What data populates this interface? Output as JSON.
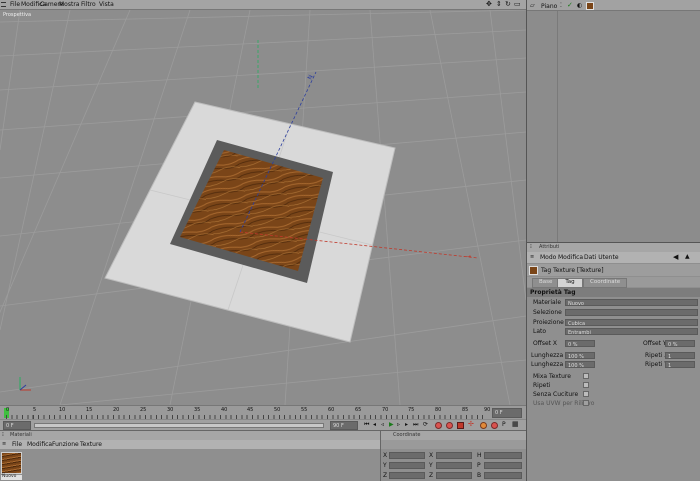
{
  "menu": {
    "items": [
      "File",
      "Modifica",
      "Camere",
      "Mostra",
      "Filtro",
      "Vista"
    ]
  },
  "viewport": {
    "label": "Prospettiva"
  },
  "object_manager": {
    "object_name": "Piano"
  },
  "timeline": {
    "ticks": [
      "0",
      "5",
      "10",
      "15",
      "20",
      "25",
      "30",
      "35",
      "40",
      "45",
      "50",
      "55",
      "60",
      "65",
      "70",
      "75",
      "80",
      "85",
      "90"
    ],
    "frame_right": "0 F",
    "start_frame": "0 F",
    "end_frame": "90 F"
  },
  "material_manager": {
    "title": "Materiali",
    "menu": [
      "File",
      "Modifica",
      "Funzione",
      "Texture"
    ],
    "material_name": "Nuovo"
  },
  "coordinates": {
    "title": "Coordinate",
    "rows": [
      {
        "a": "X",
        "b": "X",
        "c": "H"
      },
      {
        "a": "Y",
        "b": "Y",
        "c": "P"
      },
      {
        "a": "Z",
        "b": "Z",
        "c": "B"
      }
    ]
  },
  "attributes": {
    "title": "Attributi",
    "menu": [
      "Modo",
      "Modifica",
      "Dati Utente"
    ],
    "tag_title": "Tag Texture [Texture]",
    "tabs": [
      "Base",
      "Tag",
      "Coordinate"
    ],
    "section": "Proprietà Tag",
    "material_label": "Materiale",
    "material_value": "Nuovo",
    "selection_label": "Selezione",
    "projection_label": "Proiezione",
    "projection_value": "Cubica",
    "side_label": "Lato",
    "side_value": "Entrambi",
    "offset_x_label": "Offset X",
    "offset_x_value": "0 %",
    "offset_y_label": "Offset Y",
    "offset_y_value": "0 %",
    "length_x_label": "Lunghezza X",
    "length_x_value": "100 %",
    "repeat_x_label": "Ripeti X",
    "repeat_x_value": "1",
    "length_y_label": "Lunghezza Y",
    "length_y_value": "100 %",
    "repeat_y_label": "Ripeti Y",
    "repeat_y_value": "1",
    "checks": [
      "Mixa Texture",
      "Ripeti",
      "Senza Cuciture",
      "Usa UVW per Rilievo"
    ]
  },
  "colors": {
    "viewport_bg": "#8d8d8d",
    "plane": "#d9d9d9",
    "wood": "#7a4518",
    "axis_x": "#c0392b",
    "axis_y": "#27ae60",
    "axis_z": "#2c3e9e",
    "record": "#d9534f"
  }
}
